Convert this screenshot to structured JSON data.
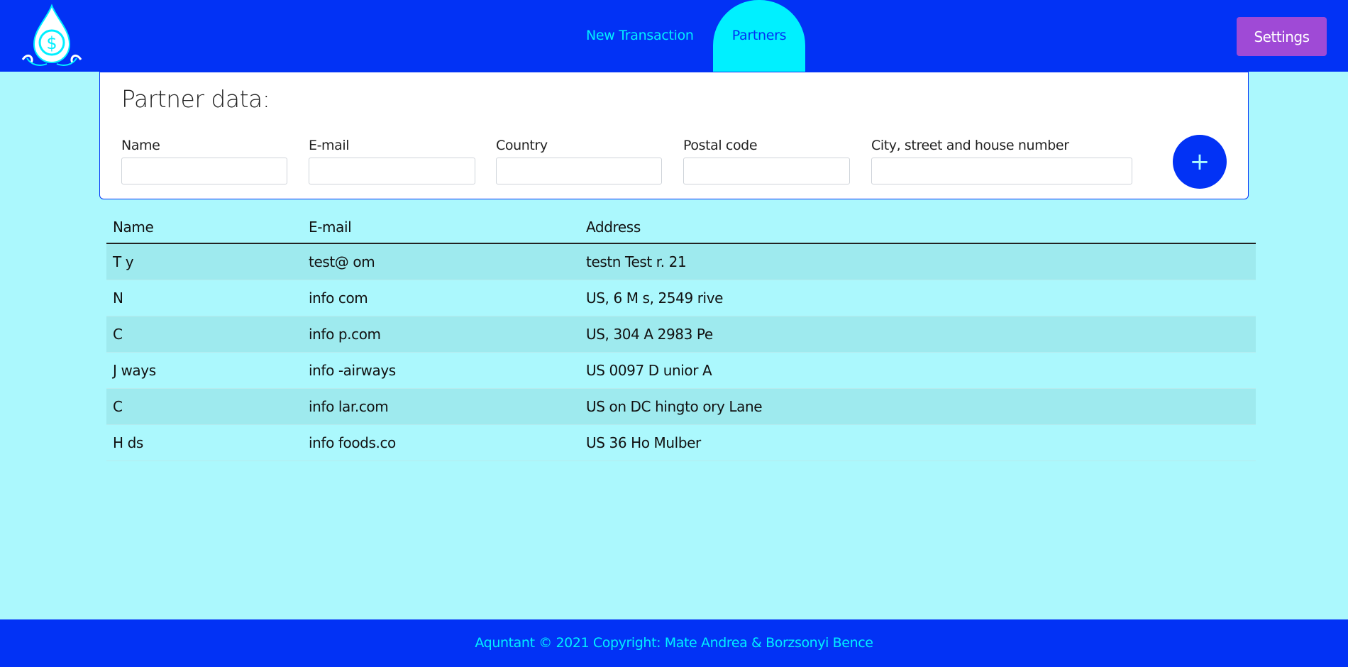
{
  "header": {
    "logo_icon": "water-drop-dollar-icon",
    "nav": [
      {
        "label": "New Transaction",
        "active": false
      },
      {
        "label": "Partners",
        "active": true
      }
    ],
    "settings_label": "Settings"
  },
  "form": {
    "title": "Partner data:",
    "fields": {
      "name": {
        "label": "Name",
        "value": ""
      },
      "email": {
        "label": "E-mail",
        "value": ""
      },
      "country": {
        "label": "Country",
        "value": ""
      },
      "postal_code": {
        "label": "Postal code",
        "value": ""
      },
      "address": {
        "label": "City, street and house number",
        "value": ""
      }
    },
    "add_label": "+"
  },
  "table": {
    "headers": [
      "Name",
      "E-mail",
      "Address"
    ],
    "rows": [
      {
        "name": "T        y",
        "email": "test@       om",
        "address": "testn          Test           r. 21"
      },
      {
        "name": "N",
        "email": "info             com",
        "address": "US,           6 M            s, 2549          rive"
      },
      {
        "name": "C",
        "email": "info            p.com",
        "address": "US,           304 A          2983 Pe"
      },
      {
        "name": "J          ways",
        "email": "info           -airways",
        "address": "US           0097 D          unior A"
      },
      {
        "name": "C",
        "email": "info           lar.com",
        "address": "US           on DC           hingto           ory Lane"
      },
      {
        "name": "H          ds",
        "email": "info           foods.co",
        "address": "US           36 Ho          Mulber"
      }
    ]
  },
  "footer": {
    "text": "Aquntant © 2021 Copyright: Mate Andrea &  Borzsonyi Bence"
  },
  "colors": {
    "navbar": "#0232f5",
    "nav_text": "#00f0ff",
    "page_background": "#abf8fd",
    "settings_button": "#9f4ad6",
    "add_button": "#0232f5",
    "striped_row": "#9eeaee"
  }
}
